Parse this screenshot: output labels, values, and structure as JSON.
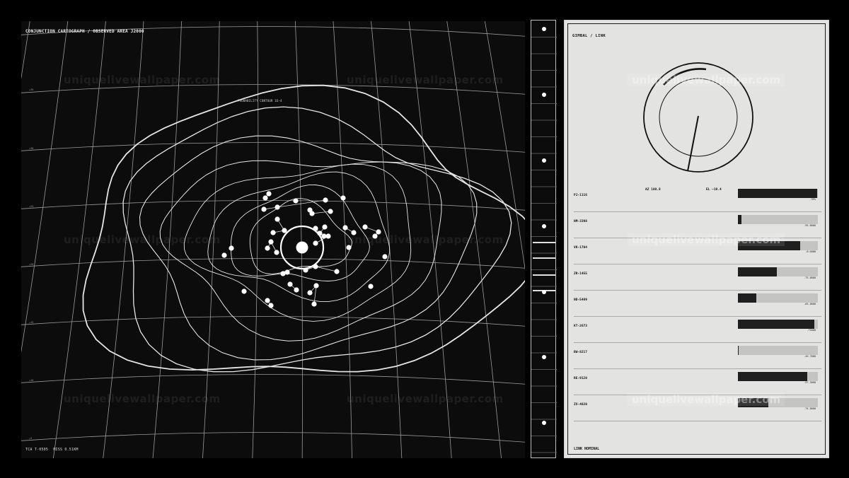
{
  "map": {
    "title": "CONJUNCTION CARTOGRAPH / OBSERVED AREA J2000",
    "contour_label": "PROBABILITY CONTOUR 1E−4",
    "lat_labels": [
      "+35",
      "+30",
      "+25",
      "+20",
      "+15",
      "+10",
      "+5"
    ],
    "footer": [
      "TCA T-0505",
      "MISS 0.51KM"
    ]
  },
  "watermark": "uniquelivewallpaper.com",
  "timeline": {
    "markers": 7,
    "active_bars": 4
  },
  "gimbal": {
    "title": "GIMBAL / LINK",
    "az": "AZ 180.8",
    "el": "EL −19.4"
  },
  "links": [
    {
      "id": "PJ-1116",
      "value": ".99%",
      "level": 0.99
    },
    {
      "id": "HM-3398",
      "value": ".95.0000",
      "level": 0.04
    },
    {
      "id": "VK-1704",
      "value": ".0.0000",
      "level": 0.78
    },
    {
      "id": "ZR-1455",
      "value": ".75.0000",
      "level": 0.49
    },
    {
      "id": "ND-5489",
      "value": ".65.0000",
      "level": 0.23
    },
    {
      "id": "KT-2673",
      "value": ".73000",
      "level": 0.96
    },
    {
      "id": "BW-8217",
      "value": ".45.7000",
      "level": 0.01
    },
    {
      "id": "RE-9128",
      "value": ".57.3000",
      "level": 0.87
    },
    {
      "id": "ZX-4820",
      "value": ".74.0000",
      "level": 0.38
    }
  ],
  "status": "LINK NOMINAL",
  "colors": {
    "map_bg": "#0b0c0b",
    "panel_bg": "#e3e4e1",
    "bar_fill": "#1f1f1f",
    "bar_track": "#c4c5c2"
  }
}
